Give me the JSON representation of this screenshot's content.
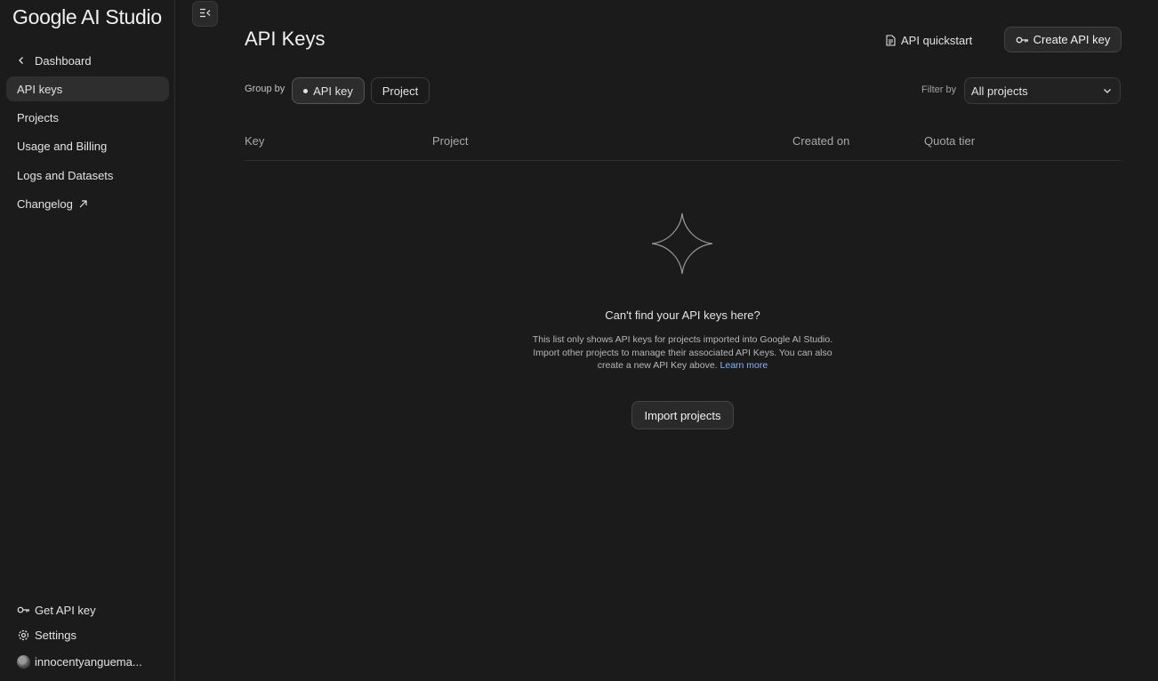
{
  "brand": "Google AI Studio",
  "sidebar": {
    "back_label": "Dashboard",
    "items": [
      {
        "label": "API keys",
        "active": true
      },
      {
        "label": "Projects"
      },
      {
        "label": "Usage and Billing"
      },
      {
        "label": "Logs and Datasets"
      },
      {
        "label": "Changelog",
        "external": true
      }
    ],
    "bottom": {
      "get_api_key": "Get API key",
      "settings": "Settings",
      "account": "innocentyanguema..."
    }
  },
  "header": {
    "title": "API Keys",
    "quickstart": "API quickstart",
    "create": "Create API key"
  },
  "toolbar": {
    "group_by_label": "Group by",
    "group_options": [
      {
        "label": "API key",
        "selected": true
      },
      {
        "label": "Project"
      }
    ],
    "filter_label": "Filter by",
    "filter_value": "All projects"
  },
  "table": {
    "columns": [
      "Key",
      "Project",
      "Created on",
      "Quota tier"
    ]
  },
  "empty_state": {
    "title": "Can't find your API keys here?",
    "text": "This list only shows API keys for projects imported into Google AI Studio. Import other projects to manage their associated API Keys. You can also create a new API Key above.",
    "link": "Learn more",
    "button": "Import projects"
  },
  "colors": {
    "background": "#1b1b1b",
    "active_item": "#2e2e2e",
    "link": "#8ab4f8"
  }
}
